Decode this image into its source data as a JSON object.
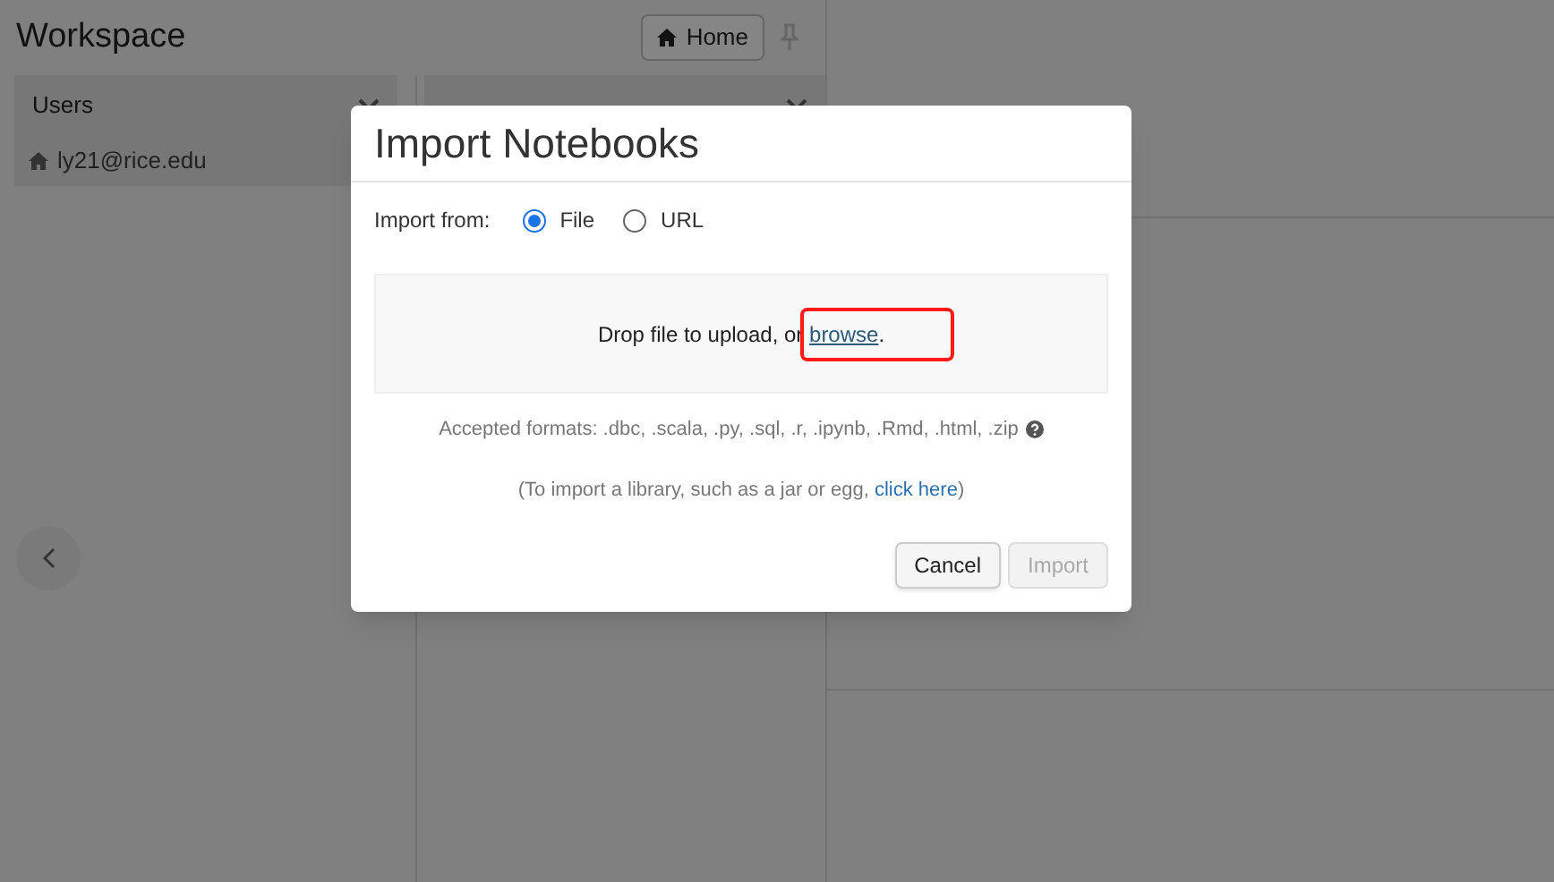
{
  "workspace": {
    "title": "Workspace",
    "home_button": "Home",
    "columns": [
      {
        "header": "Users",
        "items": [
          {
            "label": "ly21@rice.edu"
          }
        ]
      }
    ]
  },
  "dialog": {
    "title": "Import Notebooks",
    "import_from_label": "Import from:",
    "options": [
      {
        "label": "File",
        "selected": true
      },
      {
        "label": "URL",
        "selected": false
      }
    ],
    "drop_text": "Drop file to upload, or ",
    "browse_link": "browse",
    "drop_suffix": ".",
    "accepted_formats": "Accepted formats: .dbc, .scala, .py, .sql, .r, .ipynb, .Rmd, .html, .zip",
    "library_prefix": "(To import a library, such as a jar or egg, ",
    "library_link": "click here",
    "library_suffix": ")",
    "buttons": [
      {
        "label": "Cancel",
        "disabled": false
      },
      {
        "label": "Import",
        "disabled": true
      }
    ]
  }
}
